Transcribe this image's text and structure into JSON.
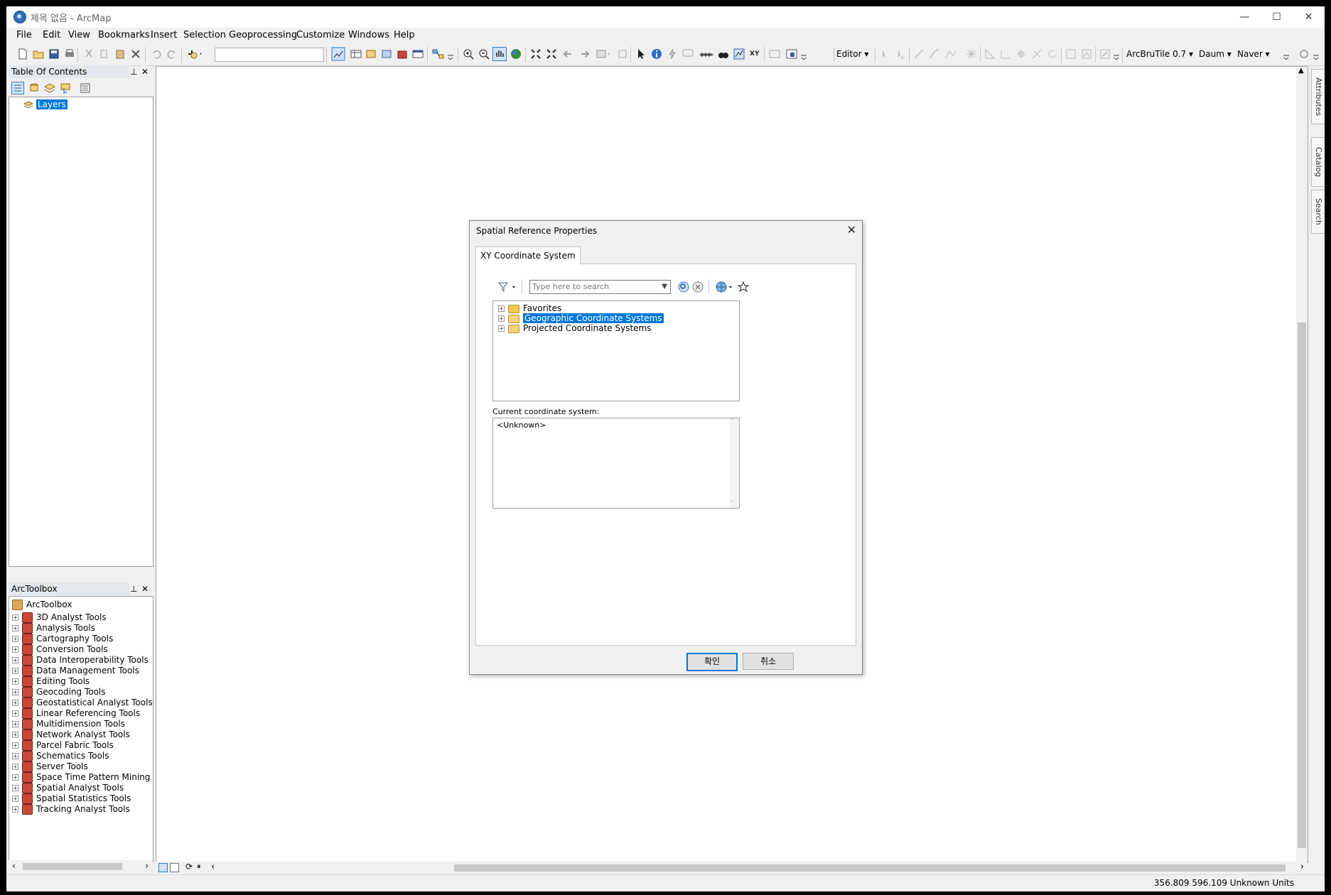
{
  "window": {
    "title": "제목 없음 - ArcMap",
    "controls": {
      "minimize": "—",
      "maximize": "☐",
      "close": "✕"
    }
  },
  "menu": [
    "File",
    "Edit",
    "View",
    "Bookmarks",
    "Insert",
    "Selection",
    "Geoprocessing",
    "Customize",
    "Windows",
    "Help"
  ],
  "toolbar": {
    "editor_label": "Editor",
    "arcbrutile_label": "ArcBruTile 0.7",
    "daum_label": "Daum",
    "naver_label": "Naver",
    "scale_value": ""
  },
  "toc": {
    "title": "Table Of Contents",
    "pin": "⊥",
    "close": "✕",
    "layers_label": "Layers"
  },
  "toolbox": {
    "title": "ArcToolbox",
    "pin": "⊥",
    "close": "✕",
    "root": "ArcToolbox",
    "items": [
      "3D Analyst Tools",
      "Analysis Tools",
      "Cartography Tools",
      "Conversion Tools",
      "Data Interoperability Tools",
      "Data Management Tools",
      "Editing Tools",
      "Geocoding Tools",
      "Geostatistical Analyst Tools",
      "Linear Referencing Tools",
      "Multidimension Tools",
      "Network Analyst Tools",
      "Parcel Fabric Tools",
      "Schematics Tools",
      "Server Tools",
      "Space Time Pattern Mining T",
      "Spatial Analyst Tools",
      "Spatial Statistics Tools",
      "Tracking Analyst Tools"
    ]
  },
  "right_dock": {
    "tabs": [
      "Attributes",
      "Catalog",
      "Search"
    ]
  },
  "dialog": {
    "title": "Spatial Reference Properties",
    "close": "✕",
    "tab": "XY Coordinate System",
    "search_placeholder": "Type here to search",
    "tree": [
      {
        "label": "Favorites",
        "selected": false
      },
      {
        "label": "Geographic Coordinate Systems",
        "selected": true
      },
      {
        "label": "Projected Coordinate Systems",
        "selected": false
      }
    ],
    "current_label": "Current coordinate system:",
    "current_value": "<Unknown>",
    "ok_button": "확인",
    "cancel_button": "취소"
  },
  "statusbar": {
    "coordinates": "356.809  596.109 Unknown Units"
  },
  "colors": {
    "selection": "#0078d7",
    "toolbox_icon": "#c9483b",
    "folder_icon": "#f4d27a"
  }
}
